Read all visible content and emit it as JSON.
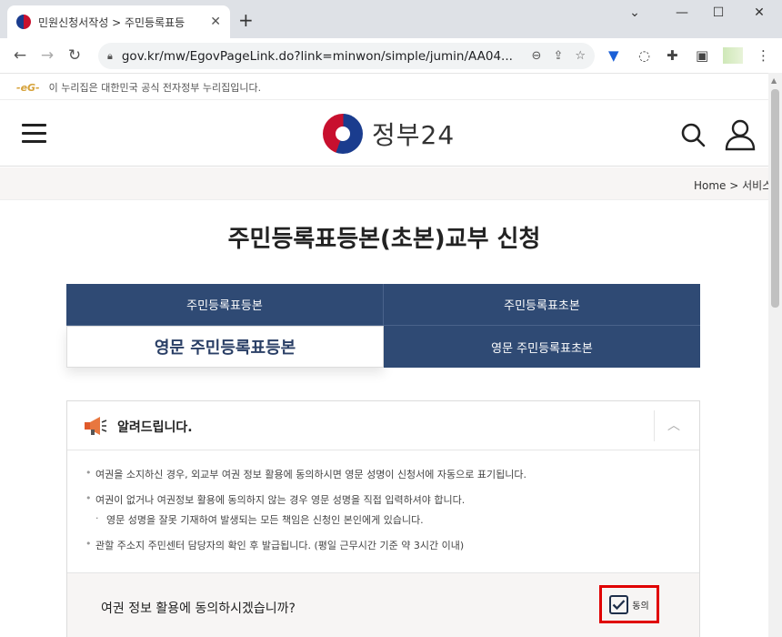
{
  "browser": {
    "tab_title": "민원신청서작성 > 주민등록표등",
    "tab_close": "✕",
    "new_tab": "+",
    "url": "gov.kr/mw/EgovPageLink.do?link=minwon/simple/jumin/AA04...",
    "window_controls": [
      "⌄",
      "—",
      "☐",
      "✕"
    ]
  },
  "gov_banner": {
    "mark": "-eG-",
    "text": "이 누리집은 대한민국 공식 전자정부 누리집입니다."
  },
  "header": {
    "logo_text": "정부24"
  },
  "breadcrumb": "Home > 서비스",
  "page_title": "주민등록표등본(초본)교부 신청",
  "tabs": [
    {
      "label": "주민등록표등본"
    },
    {
      "label": "주민등록표초본"
    },
    {
      "label": "영문 주민등록표등본"
    },
    {
      "label": "영문 주민등록표초본"
    }
  ],
  "notice": {
    "title": "알려드립니다.",
    "collapse": "︿",
    "items": [
      "여권을 소지하신 경우, 외교부 여권 정보 활용에 동의하시면 영문 성명이 신청서에 자동으로 표기됩니다.",
      "여권이 없거나 여권정보 활용에 동의하지 않는 경우 영문 성명을 직접 입력하셔야 합니다.",
      "영문 성명을 잘못 기재하여 발생되는 모든 책임은 신청인 본인에게 있습니다.",
      "관할 주소지 주민센터 담당자의 확인 후 발급됩니다. (평일 근무시간 기준 약 3시간 이내)"
    ]
  },
  "consent": {
    "question": "여권 정보 활용에 동의하시겠습니까?",
    "checkbox_label": "동의",
    "checked": true
  },
  "colors": {
    "tab_navy": "#2f4a74",
    "highlight_red": "#e00000",
    "brand_red": "#c8102e",
    "brand_blue": "#1a3c8e"
  }
}
